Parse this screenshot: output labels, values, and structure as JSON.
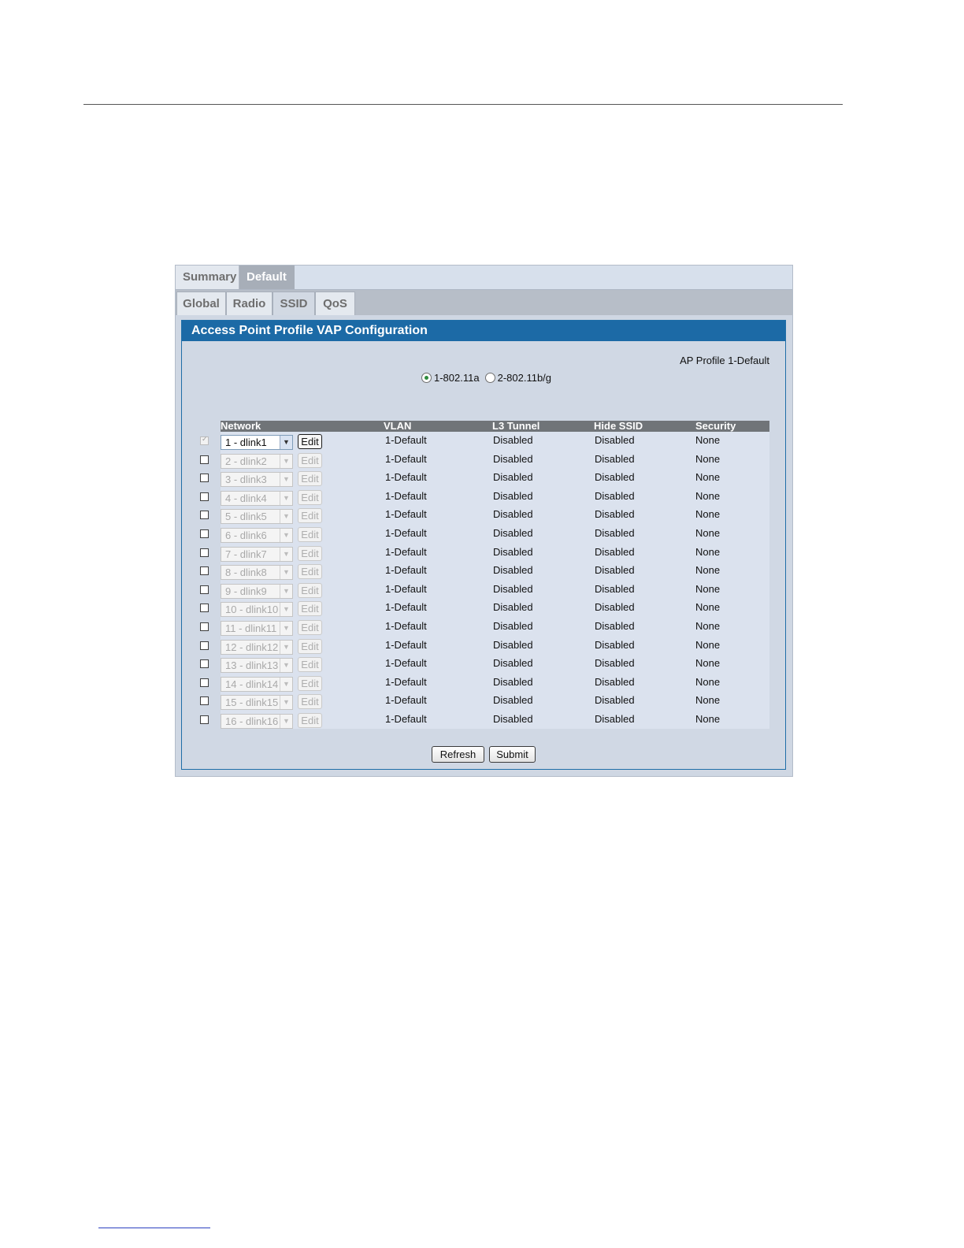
{
  "tabs_level1": [
    "Summary",
    "Default"
  ],
  "tabs_level2": [
    "Global",
    "Radio",
    "SSID",
    "QoS"
  ],
  "panel": {
    "title": "Access Point Profile VAP Configuration",
    "ap_profile": "AP Profile 1-Default",
    "radios": [
      {
        "label": "1-802.11a",
        "checked": true
      },
      {
        "label": "2-802.11b/g",
        "checked": false
      }
    ]
  },
  "table": {
    "headers": [
      "Network",
      "VLAN",
      "L3 Tunnel",
      "Hide SSID",
      "Security"
    ],
    "edit_label": "Edit",
    "rows": [
      {
        "network": "1 - dlink1",
        "vlan": "1-Default",
        "l3_tunnel": "Disabled",
        "hide_ssid": "Disabled",
        "security": "None",
        "enabled": true
      },
      {
        "network": "2 - dlink2",
        "vlan": "1-Default",
        "l3_tunnel": "Disabled",
        "hide_ssid": "Disabled",
        "security": "None",
        "enabled": false
      },
      {
        "network": "3 - dlink3",
        "vlan": "1-Default",
        "l3_tunnel": "Disabled",
        "hide_ssid": "Disabled",
        "security": "None",
        "enabled": false
      },
      {
        "network": "4 - dlink4",
        "vlan": "1-Default",
        "l3_tunnel": "Disabled",
        "hide_ssid": "Disabled",
        "security": "None",
        "enabled": false
      },
      {
        "network": "5 - dlink5",
        "vlan": "1-Default",
        "l3_tunnel": "Disabled",
        "hide_ssid": "Disabled",
        "security": "None",
        "enabled": false
      },
      {
        "network": "6 - dlink6",
        "vlan": "1-Default",
        "l3_tunnel": "Disabled",
        "hide_ssid": "Disabled",
        "security": "None",
        "enabled": false
      },
      {
        "network": "7 - dlink7",
        "vlan": "1-Default",
        "l3_tunnel": "Disabled",
        "hide_ssid": "Disabled",
        "security": "None",
        "enabled": false
      },
      {
        "network": "8 - dlink8",
        "vlan": "1-Default",
        "l3_tunnel": "Disabled",
        "hide_ssid": "Disabled",
        "security": "None",
        "enabled": false
      },
      {
        "network": "9 - dlink9",
        "vlan": "1-Default",
        "l3_tunnel": "Disabled",
        "hide_ssid": "Disabled",
        "security": "None",
        "enabled": false
      },
      {
        "network": "10 - dlink10",
        "vlan": "1-Default",
        "l3_tunnel": "Disabled",
        "hide_ssid": "Disabled",
        "security": "None",
        "enabled": false
      },
      {
        "network": "11 - dlink11",
        "vlan": "1-Default",
        "l3_tunnel": "Disabled",
        "hide_ssid": "Disabled",
        "security": "None",
        "enabled": false
      },
      {
        "network": "12 - dlink12",
        "vlan": "1-Default",
        "l3_tunnel": "Disabled",
        "hide_ssid": "Disabled",
        "security": "None",
        "enabled": false
      },
      {
        "network": "13 - dlink13",
        "vlan": "1-Default",
        "l3_tunnel": "Disabled",
        "hide_ssid": "Disabled",
        "security": "None",
        "enabled": false
      },
      {
        "network": "14 - dlink14",
        "vlan": "1-Default",
        "l3_tunnel": "Disabled",
        "hide_ssid": "Disabled",
        "security": "None",
        "enabled": false
      },
      {
        "network": "15 - dlink15",
        "vlan": "1-Default",
        "l3_tunnel": "Disabled",
        "hide_ssid": "Disabled",
        "security": "None",
        "enabled": false
      },
      {
        "network": "16 - dlink16",
        "vlan": "1-Default",
        "l3_tunnel": "Disabled",
        "hide_ssid": "Disabled",
        "security": "None",
        "enabled": false
      }
    ]
  },
  "buttons": {
    "refresh": "Refresh",
    "submit": "Submit"
  },
  "colors": {
    "title_bar": "#1c6aa6",
    "header_bar": "#707478",
    "panel_bg": "#d0d8e4"
  }
}
